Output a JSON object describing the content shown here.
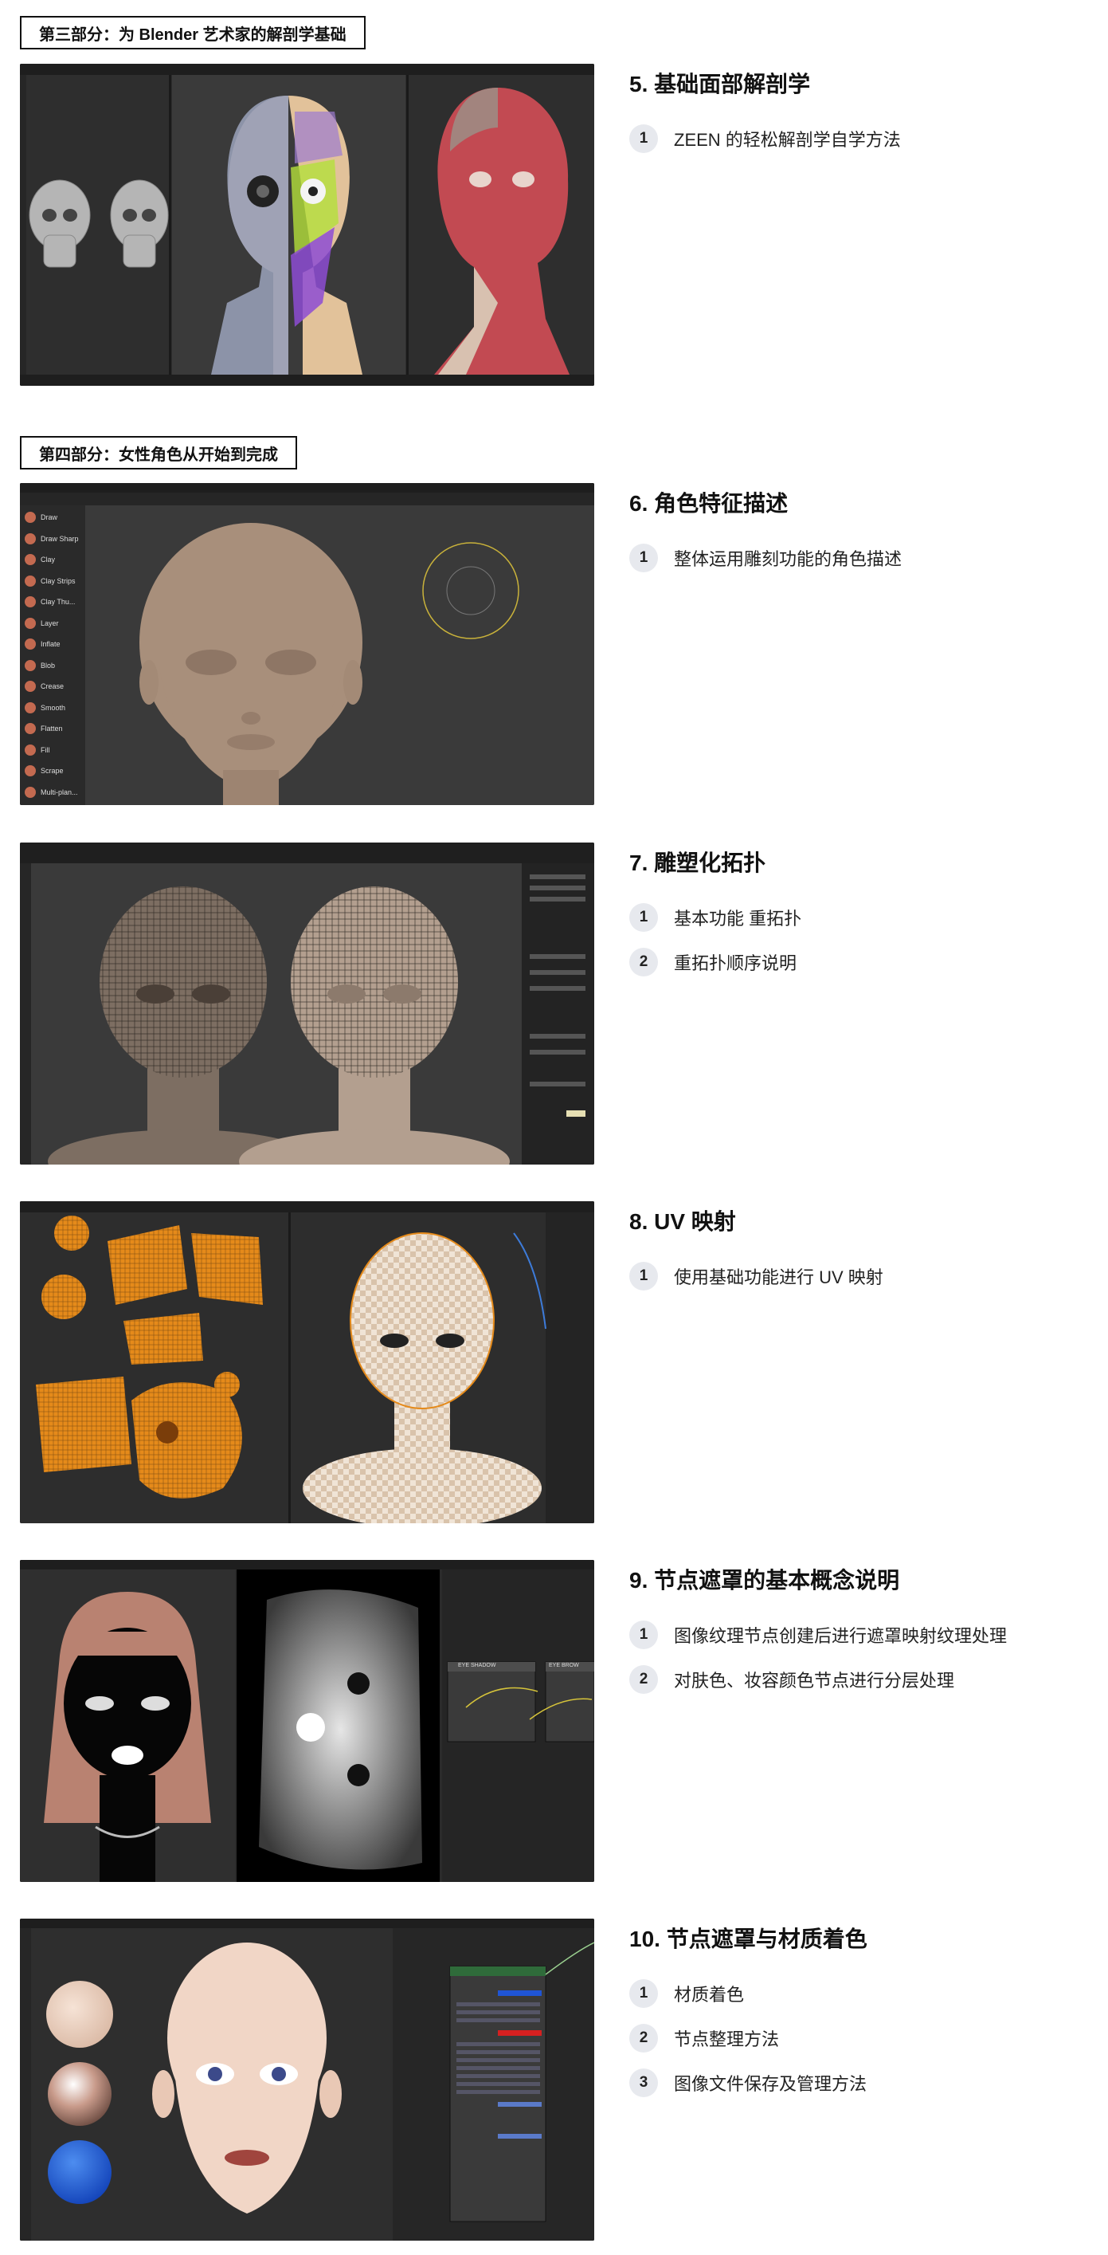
{
  "part3": {
    "label": "第三部分：为 Blender 艺术家的解剖学基础"
  },
  "part4": {
    "label": "第四部分：女性角色从开始到完成"
  },
  "sections": [
    {
      "title": "5. 基础面部解剖学",
      "items": [
        {
          "num": "1",
          "text": "ZEEN 的轻松解剖学自学方法"
        }
      ]
    },
    {
      "title": "6. 角色特征描述",
      "items": [
        {
          "num": "1",
          "text": "整体运用雕刻功能的角色描述"
        }
      ]
    },
    {
      "title": "7. 雕塑化拓扑",
      "items": [
        {
          "num": "1",
          "text": "基本功能 重拓扑"
        },
        {
          "num": "2",
          "text": "重拓扑顺序说明"
        }
      ]
    },
    {
      "title": "8. UV 映射",
      "items": [
        {
          "num": "1",
          "text": "使用基础功能进行 UV 映射"
        }
      ]
    },
    {
      "title": "9. 节点遮罩的基本概念说明",
      "items": [
        {
          "num": "1",
          "text": "图像纹理节点创建后进行遮罩映射纹理处理"
        },
        {
          "num": "2",
          "text": "对肤色、妆容颜色节点进行分层处理"
        }
      ]
    },
    {
      "title": "10. 节点遮罩与材质着色",
      "items": [
        {
          "num": "1",
          "text": "材质着色"
        },
        {
          "num": "2",
          "text": "节点整理方法"
        },
        {
          "num": "3",
          "text": "图像文件保存及管理方法"
        }
      ]
    }
  ],
  "screenshots": {
    "sculpt_brushes": [
      "Draw",
      "Draw Sharp",
      "Clay",
      "Clay Strips",
      "Clay Thu...",
      "Layer",
      "Inflate",
      "Blob",
      "Crease",
      "Smooth",
      "Flatten",
      "Fill",
      "Scrape",
      "Multi-plan..."
    ],
    "node_labels": [
      "EYE SHADOW",
      "EYE BROW"
    ]
  },
  "colors": {
    "ui_dark": "#2b2b2b",
    "skin": "#a88f7b",
    "muscle": "#c24a52",
    "uv_orange": "#e58a1a",
    "accent_blue": "#3d7bd9"
  }
}
